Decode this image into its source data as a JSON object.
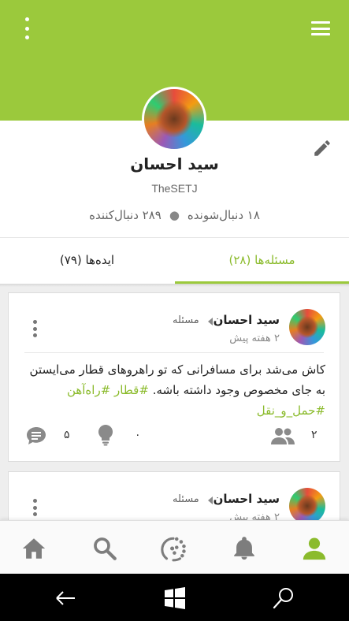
{
  "header": {
    "menu_icon": "kebab-menu-icon",
    "nav_icon": "hamburger-menu-icon",
    "color": "#9bc93c"
  },
  "profile": {
    "name": "سید احسان",
    "username": "TheSETJ",
    "followers": "۲۸۹ دنبال‌کننده",
    "following": "۱۸ دنبال‌شونده",
    "edit_icon": "pencil-icon"
  },
  "tabs": [
    {
      "label": "مسئله‌ها (۲۸)",
      "active": true
    },
    {
      "label": "ایده‌ها (۷۹)",
      "active": false
    }
  ],
  "posts": [
    {
      "author": "سید احسان",
      "type": "مسئله",
      "time": "۲ هفته پیش",
      "text": "کاش می‌شد برای مسافرانی که تو راهروهای قطار می‌ایستن به جای مخصوص وجود داشته باشه.",
      "tags": "#قطار #راه‌آهن #حمل_و_نقل",
      "followers_count": "۲",
      "ideas_count": "۰",
      "comments_count": "۵"
    },
    {
      "author": "سید احسان",
      "type": "مسئله",
      "time": "۲ هفته پیش"
    }
  ],
  "bottom_nav": [
    "home-icon",
    "search-icon",
    "ideas-icon",
    "bell-icon",
    "profile-icon"
  ],
  "system_bar": [
    "back-icon",
    "windows-icon",
    "search-icon"
  ]
}
